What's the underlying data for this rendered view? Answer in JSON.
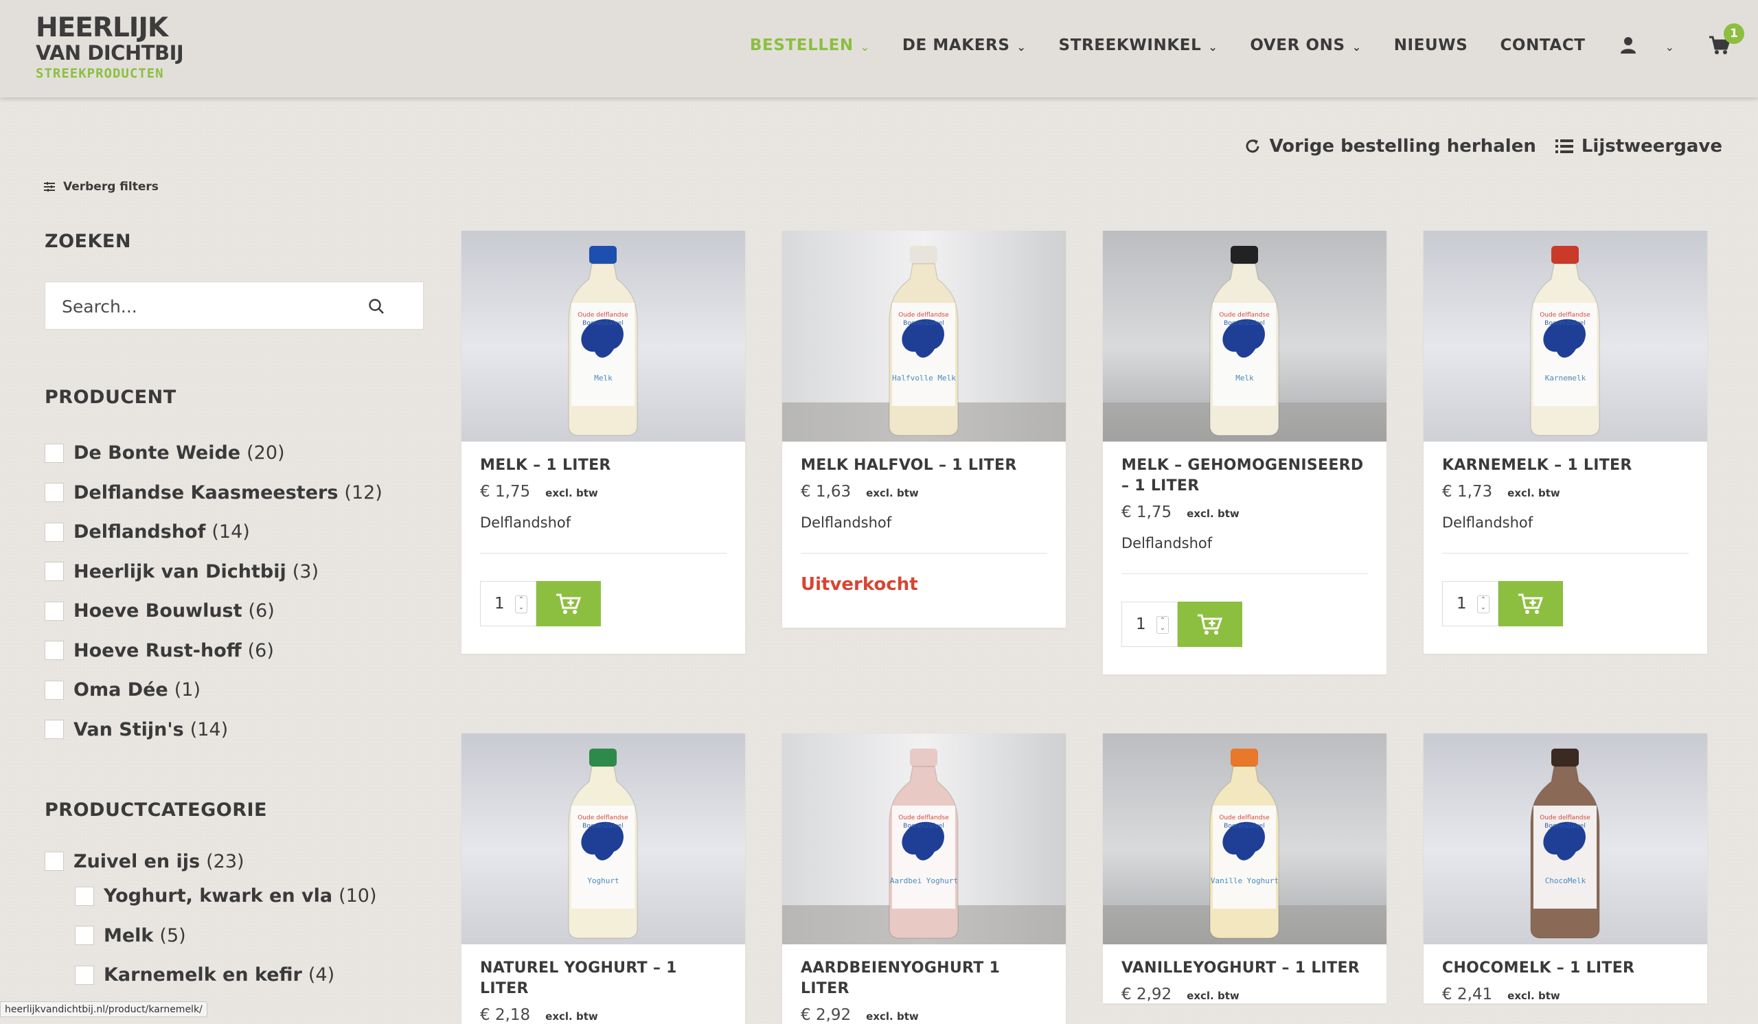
{
  "logo": {
    "line1": "HEERLIJK",
    "line2": "VAN DICHTBIJ",
    "line3": "STREEKPRODUCTEN"
  },
  "nav": {
    "items": [
      {
        "label": "BESTELLEN",
        "dropdown": true,
        "active": true
      },
      {
        "label": "DE MAKERS",
        "dropdown": true
      },
      {
        "label": "STREEKWINKEL",
        "dropdown": true
      },
      {
        "label": "OVER ONS",
        "dropdown": true
      },
      {
        "label": "NIEUWS",
        "dropdown": false
      },
      {
        "label": "CONTACT",
        "dropdown": false
      }
    ],
    "account_icon": "user-icon",
    "cart_icon": "cart-icon",
    "cart_count": "1"
  },
  "top_actions": {
    "repeat_order": "Vorige bestelling herhalen",
    "list_view": "Lijstweergave"
  },
  "sidebar": {
    "hide_filters": "Verberg filters",
    "search_heading": "ZOEKEN",
    "search_placeholder": "Search...",
    "producer_heading": "PRODUCENT",
    "producers": [
      {
        "name": "De Bonte Weide",
        "count": "(20)"
      },
      {
        "name": "Delflandse Kaasmeesters",
        "count": "(12)"
      },
      {
        "name": "Delflandshof",
        "count": "(14)"
      },
      {
        "name": "Heerlijk van Dichtbij",
        "count": "(3)"
      },
      {
        "name": "Hoeve Bouwlust",
        "count": "(6)"
      },
      {
        "name": "Hoeve Rust-hoff",
        "count": "(6)"
      },
      {
        "name": "Oma Dée",
        "count": "(1)"
      },
      {
        "name": "Van Stijn's",
        "count": "(14)"
      }
    ],
    "category_heading": "PRODUCTCATEGORIE",
    "categories": [
      {
        "name": "Zuivel en ijs",
        "count": "(23)",
        "sub": false
      },
      {
        "name": "Yoghurt, kwark en vla",
        "count": "(10)",
        "sub": true
      },
      {
        "name": "Melk",
        "count": "(5)",
        "sub": true
      },
      {
        "name": "Karnemelk en kefir",
        "count": "(4)",
        "sub": true
      }
    ]
  },
  "products": [
    {
      "title": "MELK – 1 LITER",
      "price": "€ 1,75",
      "excl": "excl. btw",
      "maker": "Delflandshof",
      "qty": "1",
      "soldout": false,
      "cap": "#1d4fb0",
      "liquid": "#f3ecd6",
      "label": "Melk"
    },
    {
      "title": "MELK HALFVOL – 1 LITER",
      "price": "€ 1,63",
      "excl": "excl. btw",
      "maker": "Delflandshof",
      "soldout": true,
      "soldout_label": "Uitverkocht",
      "cap": "#e8e4dc",
      "liquid": "#f0e6c9",
      "label": "Halfvolle Melk"
    },
    {
      "title": "MELK – GEHOMOGENISEERD – 1 LITER",
      "price": "€ 1,75",
      "excl": "excl. btw",
      "maker": "Delflandshof",
      "qty": "1",
      "soldout": false,
      "cap": "#222222",
      "liquid": "#f2ecda",
      "label": "Melk"
    },
    {
      "title": "KARNEMELK – 1 LITER",
      "price": "€ 1,73",
      "excl": "excl. btw",
      "maker": "Delflandshof",
      "qty": "1",
      "soldout": false,
      "cap": "#c93a2a",
      "liquid": "#f4efdc",
      "label": "Karnemelk"
    },
    {
      "title": "NATUREL YOGHURT – 1 LITER",
      "price": "€ 2,18",
      "excl": "excl. btw",
      "cap": "#2e8a4a",
      "liquid": "#f4efd8",
      "label": "Yoghurt"
    },
    {
      "title": "AARDBEIENYOGHURT 1 LITER",
      "price": "€ 2,92",
      "excl": "excl. btw",
      "cap": "#e7c9c6",
      "liquid": "#e9c9c3",
      "label": "Aardbei Yoghurt"
    },
    {
      "title": "VANILLEYOGHURT – 1 LITER",
      "price": "€ 2,92",
      "excl": "excl. btw",
      "cap": "#e8782a",
      "liquid": "#f3e7bf",
      "label": "Vanille Yoghurt"
    },
    {
      "title": "CHOCOMELK – 1 LITER",
      "price": "€ 2,41",
      "excl": "excl. btw",
      "cap": "#3b2a22",
      "liquid": "#8a6a56",
      "label": "ChocoMelk"
    }
  ],
  "status_url": "heerlijkvandichtbij.nl/product/karnemelk/",
  "colors": {
    "accent": "#8cbf3f",
    "soldout": "#d64532",
    "text": "#3a3a3a"
  }
}
